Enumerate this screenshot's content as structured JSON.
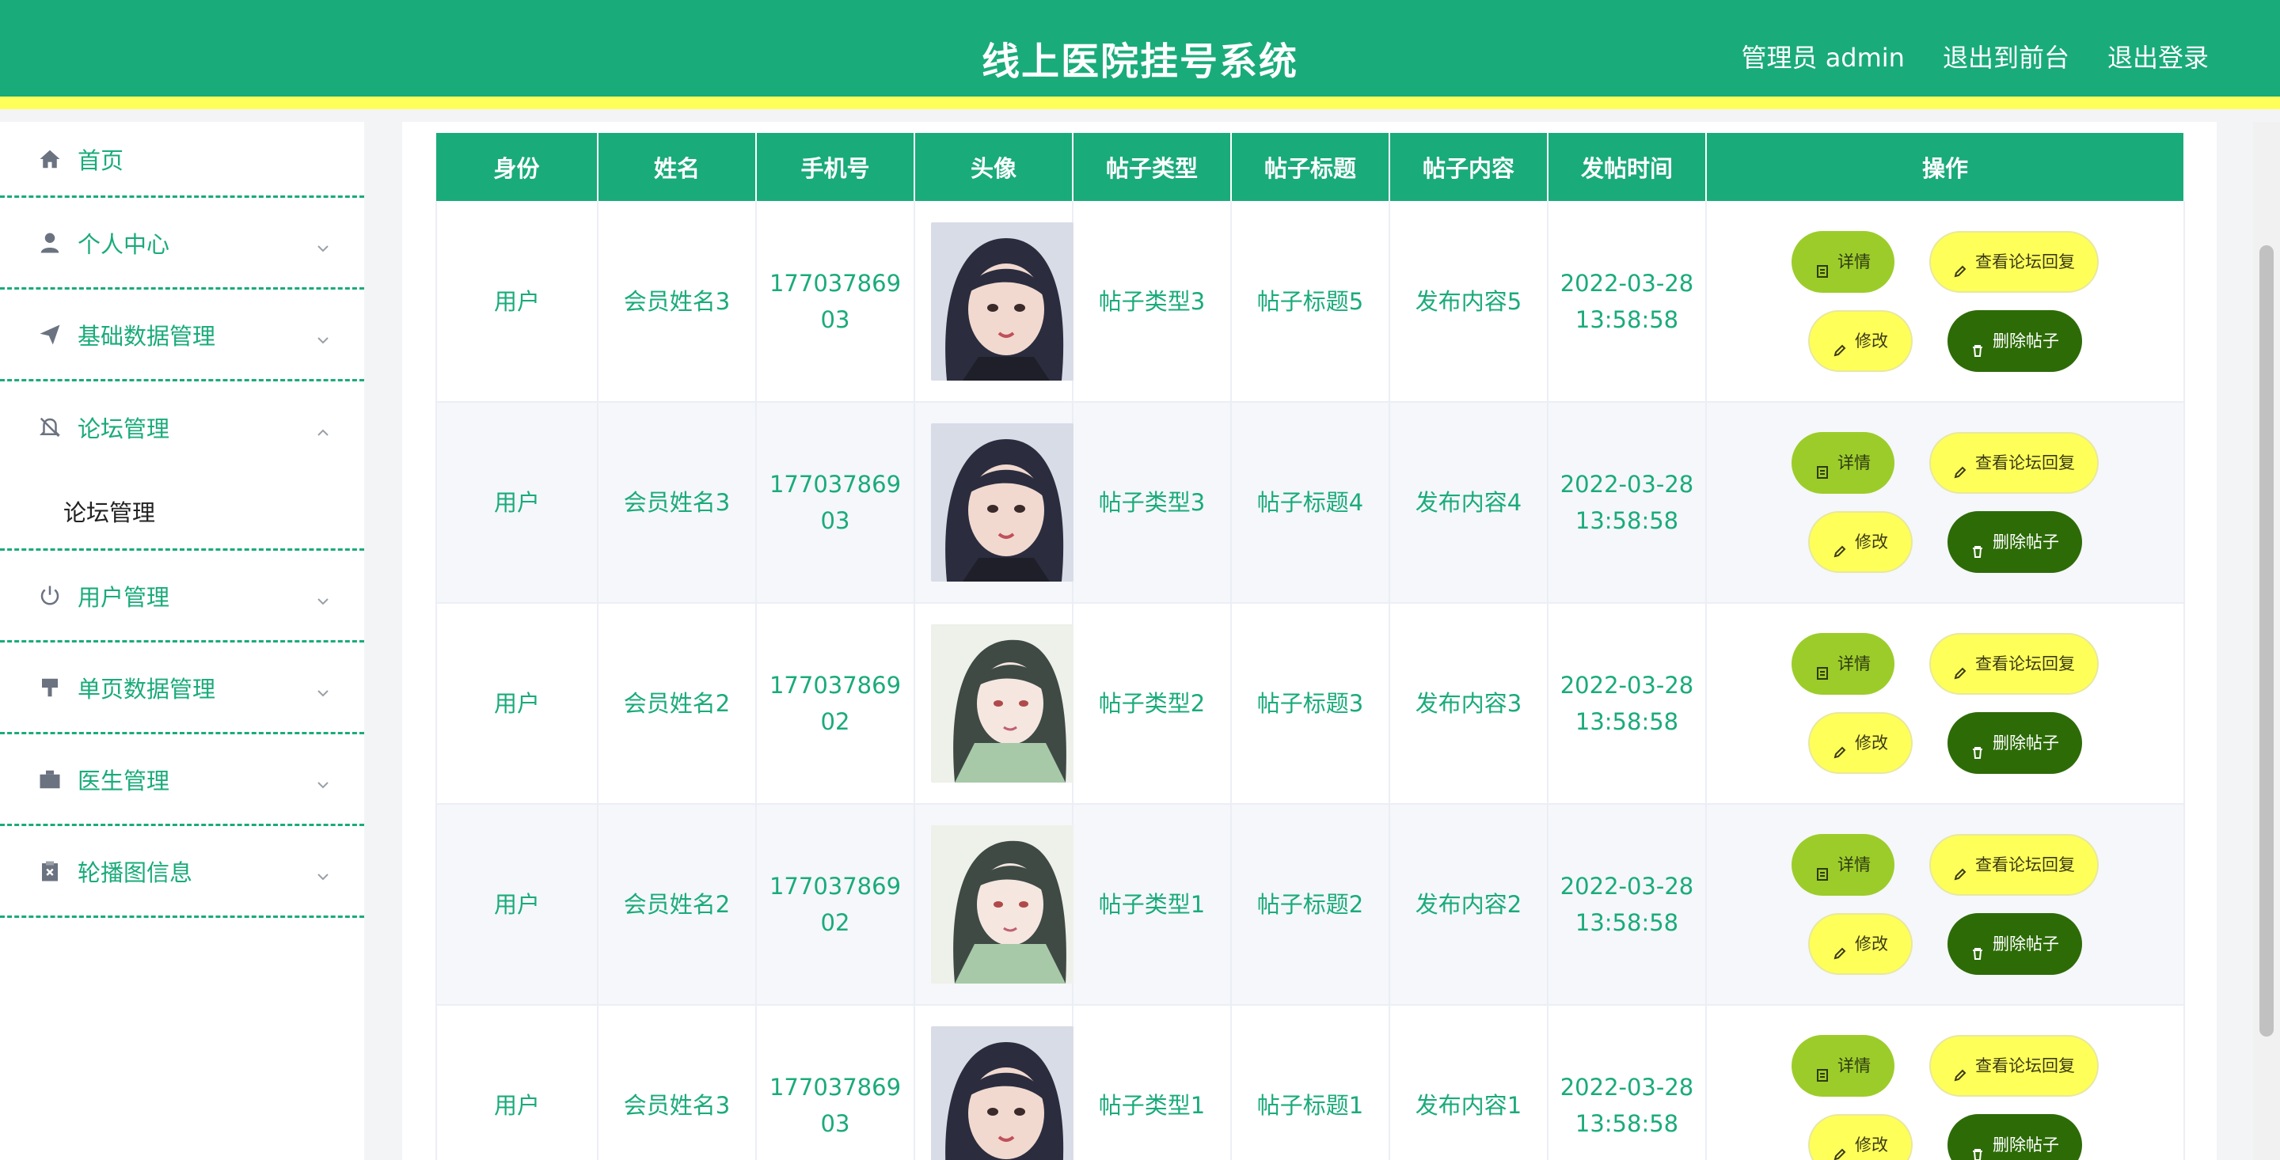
{
  "header": {
    "title": "线上医院挂号系统",
    "user_label": "管理员 admin",
    "to_front_label": "退出到前台",
    "logout_label": "退出登录"
  },
  "sidebar": {
    "home": "首页",
    "personal": "个人中心",
    "basic_data": "基础数据管理",
    "forum": "论坛管理",
    "forum_sub": "论坛管理",
    "users": "用户管理",
    "single_page": "单页数据管理",
    "doctors": "医生管理",
    "carousel": "轮播图信息"
  },
  "table": {
    "headers": [
      "身份",
      "姓名",
      "手机号",
      "头像",
      "帖子类型",
      "帖子标题",
      "帖子内容",
      "发帖时间",
      "操作"
    ],
    "rows": [
      {
        "role": "用户",
        "name": "会员姓名3",
        "phone_1": "177037869",
        "phone_2": "03",
        "avatar": "avatar-1",
        "type": "帖子类型3",
        "title": "帖子标题5",
        "content": "发布内容5",
        "date": "2022-03-28",
        "time": "13:58:58"
      },
      {
        "role": "用户",
        "name": "会员姓名3",
        "phone_1": "177037869",
        "phone_2": "03",
        "avatar": "avatar-1",
        "type": "帖子类型3",
        "title": "帖子标题4",
        "content": "发布内容4",
        "date": "2022-03-28",
        "time": "13:58:58"
      },
      {
        "role": "用户",
        "name": "会员姓名2",
        "phone_1": "177037869",
        "phone_2": "02",
        "avatar": "avatar-2",
        "type": "帖子类型2",
        "title": "帖子标题3",
        "content": "发布内容3",
        "date": "2022-03-28",
        "time": "13:58:58"
      },
      {
        "role": "用户",
        "name": "会员姓名2",
        "phone_1": "177037869",
        "phone_2": "02",
        "avatar": "avatar-2",
        "type": "帖子类型1",
        "title": "帖子标题2",
        "content": "发布内容2",
        "date": "2022-03-28",
        "time": "13:58:58"
      },
      {
        "role": "用户",
        "name": "会员姓名3",
        "phone_1": "177037869",
        "phone_2": "03",
        "avatar": "avatar-1",
        "type": "帖子类型1",
        "title": "帖子标题1",
        "content": "发布内容1",
        "date": "2022-03-28",
        "time": "13:58:58"
      }
    ]
  },
  "actions": {
    "detail": "详情",
    "reply": "查看论坛回复",
    "edit": "修改",
    "delete": "删除帖子"
  },
  "colors": {
    "primary": "#1aab7a",
    "accent_yellow": "#ffff59",
    "detail_green": "#9ccc2a",
    "delete_green": "#2d6b07"
  }
}
